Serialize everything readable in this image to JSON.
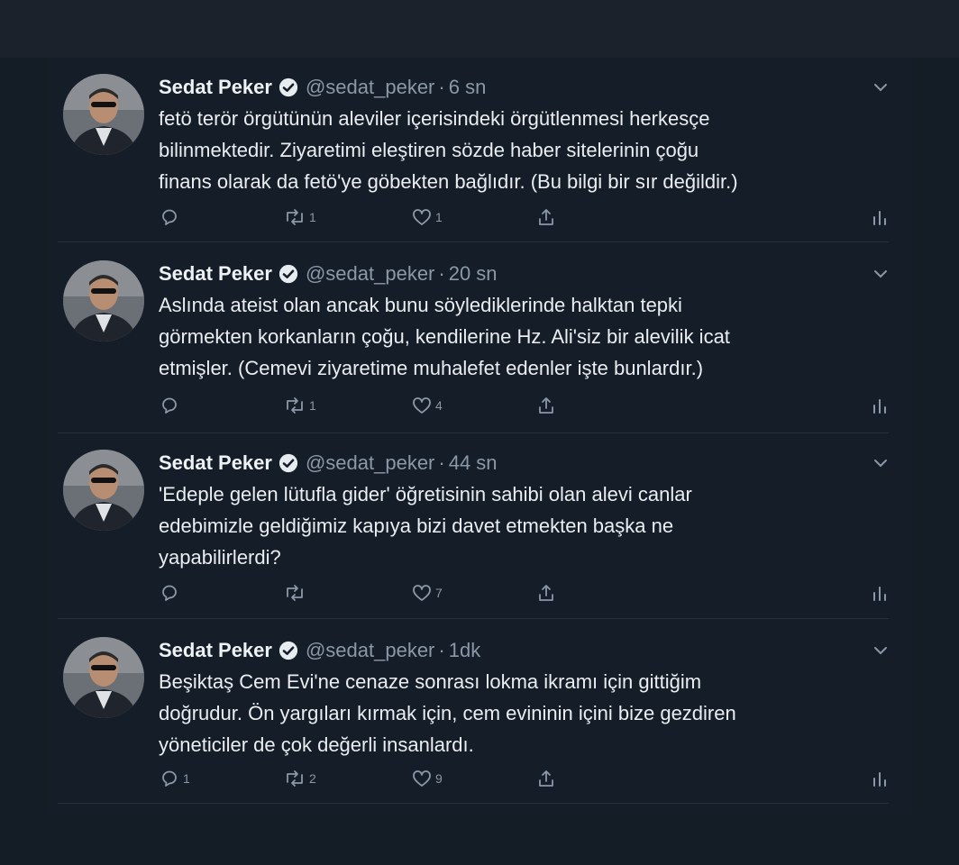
{
  "author": {
    "name": "Sedat Peker",
    "handle": "@sedat_peker",
    "separator": "·"
  },
  "tweets": [
    {
      "time": "6 sn",
      "text": "fetö terör örgütünün aleviler içerisindeki örgütlenmesi herkesçe\nbilinmektedir. Ziyaretimi eleştiren sözde haber sitelerinin çoğu\nfinans olarak da fetö'ye göbekten bağlıdır. (Bu bilgi bir sır değildir.)",
      "replies": "",
      "retweets": "1",
      "likes": "1"
    },
    {
      "time": "20 sn",
      "text": "Aslında ateist olan ancak bunu söylediklerinde halktan tepki\ngörmekten korkanların çoğu, kendilerine Hz. Ali'siz bir alevilik icat\netmişler. (Cemevi ziyaretime muhalefet edenler işte bunlardır.)",
      "replies": "",
      "retweets": "1",
      "likes": "4"
    },
    {
      "time": "44 sn",
      "text": "'Edeple gelen lütufla gider' öğretisinin sahibi olan alevi canlar\nedebimizle geldiğimiz kapıya bizi davet etmekten başka ne\nyapabilirlerdi?",
      "replies": "",
      "retweets": "",
      "likes": "7"
    },
    {
      "time": "1dk",
      "text": "Beşiktaş Cem Evi'ne cenaze sonrası lokma ikramı için gittiğim\ndoğrudur. Ön yargıları kırmak için, cem evininin içini bize gezdiren\nyöneticiler de çok değerli insanlardı.",
      "replies": "1",
      "retweets": "2",
      "likes": "9"
    }
  ],
  "icons": {
    "reply": "reply-icon",
    "retweet": "retweet-icon",
    "like": "heart-icon",
    "share": "share-icon",
    "analytics": "analytics-icon",
    "verified": "verified-icon",
    "menu": "chevron-down-icon"
  },
  "colors": {
    "background": "#141c26",
    "text": "#eaeef2",
    "muted": "#8a98a8"
  }
}
